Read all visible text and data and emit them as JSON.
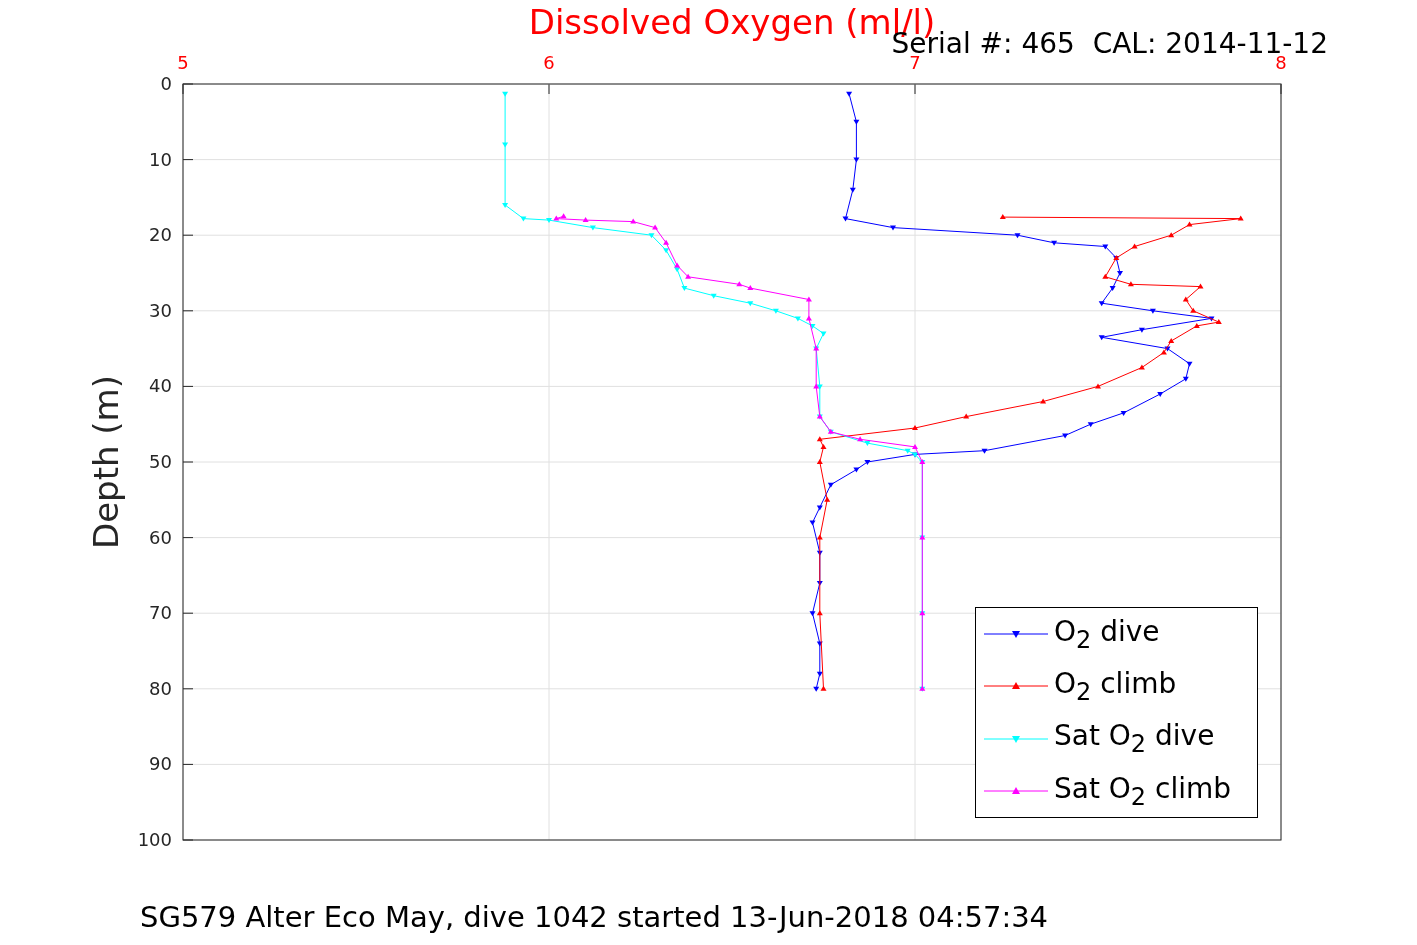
{
  "chart_data": {
    "type": "line",
    "title": "Dissolved Oxygen (ml/l)",
    "ylabel": "Depth (m)",
    "xlim": [
      5,
      8
    ],
    "ylim": [
      100,
      0
    ],
    "xticks": [
      5,
      6,
      7,
      8
    ],
    "yticks": [
      0,
      10,
      20,
      30,
      40,
      50,
      60,
      70,
      80,
      90,
      100
    ],
    "grid": true,
    "series": [
      {
        "name": "O$_{2}$ dive",
        "color": "#0000ff",
        "x": [
          6.82,
          6.84,
          6.84,
          6.83,
          6.81,
          6.94,
          7.28,
          7.38,
          7.52,
          7.55,
          7.56,
          7.54,
          7.51,
          7.65,
          7.81,
          7.62,
          7.51,
          7.69,
          7.75,
          7.74,
          7.67,
          7.57,
          7.48,
          7.41,
          7.19,
          7.0,
          6.87,
          6.84,
          6.77,
          6.74,
          6.72,
          6.74,
          6.74,
          6.72,
          6.74,
          6.74,
          6.73
        ],
        "values": [
          1.3,
          5,
          10,
          14,
          17.8,
          19,
          20,
          21,
          21.5,
          23,
          25,
          27,
          29,
          30,
          31,
          32.5,
          33.5,
          35,
          37,
          39,
          41,
          43.5,
          45,
          46.5,
          48.5,
          49,
          50,
          51,
          53,
          56,
          58,
          62,
          66,
          70,
          74,
          78,
          80
        ]
      },
      {
        "name": "O$_{2}$ climb",
        "color": "#ff0000",
        "x": [
          7.24,
          7.89,
          7.75,
          7.7,
          7.6,
          7.55,
          7.52,
          7.59,
          7.78,
          7.74,
          7.76,
          7.83,
          7.77,
          7.7,
          7.68,
          7.62,
          7.5,
          7.35,
          7.14,
          7.0,
          6.74,
          6.75,
          6.74,
          6.76,
          6.74,
          6.74,
          6.75
        ],
        "values": [
          17.6,
          17.8,
          18.6,
          20,
          21.5,
          23,
          25.5,
          26.5,
          26.8,
          28.5,
          30,
          31.5,
          32,
          34,
          35.5,
          37.5,
          40,
          42,
          44,
          45.5,
          47,
          48,
          50,
          55,
          60,
          70,
          80
        ]
      },
      {
        "name": "Sat O$_{2}$ dive",
        "color": "#00ffff",
        "x": [
          5.88,
          5.88,
          5.88,
          5.93,
          6.0,
          6.12,
          6.28,
          6.32,
          6.35,
          6.37,
          6.45,
          6.55,
          6.62,
          6.68,
          6.72,
          6.75,
          6.73,
          6.74,
          6.74,
          6.77,
          6.87,
          6.98,
          7.0,
          7.02,
          7.02,
          7.02,
          7.02
        ],
        "values": [
          1.3,
          8,
          16,
          17.8,
          18,
          19,
          20,
          22,
          24.5,
          27,
          28,
          29,
          30,
          31,
          32,
          33,
          35,
          40,
          44,
          46,
          47.5,
          48.5,
          49,
          50,
          60,
          70,
          80
        ]
      },
      {
        "name": "Sat O$_{2}$ climb",
        "color": "#ff00ff",
        "x": [
          6.04,
          6.02,
          6.1,
          6.23,
          6.29,
          6.32,
          6.35,
          6.38,
          6.52,
          6.55,
          6.71,
          6.71,
          6.73,
          6.73,
          6.74,
          6.77,
          6.85,
          7.0,
          7.02,
          7.02,
          7.02,
          7.02
        ],
        "values": [
          17.5,
          17.8,
          18,
          18.2,
          19,
          21,
          24,
          25.5,
          26.5,
          27,
          28.5,
          31,
          35,
          40,
          44,
          46,
          47,
          48,
          50,
          60,
          70,
          80
        ]
      }
    ]
  },
  "serial_label": "Serial #: 465  CAL: 2014-11-12",
  "caption": "SG579 Alter Eco May, dive 1042 started 13-Jun-2018 04:57:34"
}
